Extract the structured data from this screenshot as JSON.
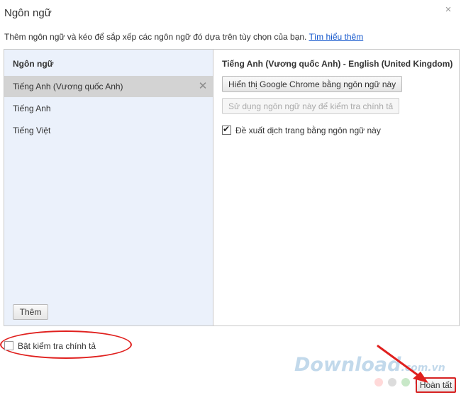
{
  "dialog": {
    "title": "Ngôn ngữ",
    "close_glyph": "×",
    "description": "Thêm ngôn ngữ và kéo để sắp xếp các ngôn ngữ đó dựa trên tùy chọn của bạn.",
    "learn_more": "Tìm hiểu thêm"
  },
  "languages": {
    "header": "Ngôn ngữ",
    "items": [
      {
        "label": "Tiếng Anh (Vương quốc Anh)",
        "selected": true
      },
      {
        "label": "Tiếng Anh",
        "selected": false
      },
      {
        "label": "Tiếng Việt",
        "selected": false
      }
    ],
    "remove_glyph": "✕",
    "add_label": "Thêm"
  },
  "details": {
    "title": "Tiếng Anh (Vương quốc Anh) - English (United Kingdom)",
    "display_button": "Hiển thị Google Chrome bằng ngôn ngữ này",
    "spellcheck_button": "Sử dụng ngôn ngữ này để kiểm tra chính tả",
    "translate_label": "Đề xuất dịch trang bằng ngôn ngữ này",
    "translate_checked": true
  },
  "footer": {
    "spellcheck_label": "Bật kiểm tra chính tả",
    "spellcheck_checked": false,
    "done_label": "Hoàn tất"
  },
  "watermark": {
    "brand": "Download",
    "suffix": ".com.vn"
  },
  "colors": {
    "highlight_red": "#e0201e",
    "link_blue": "#1155cc",
    "left_pane_bg": "#ebf1fb",
    "selected_bg": "#d3d3d3",
    "dot_colors": [
      "#ffd9d9",
      "#dcdcdc",
      "#c8e8c8",
      "#d6e4f5"
    ]
  }
}
